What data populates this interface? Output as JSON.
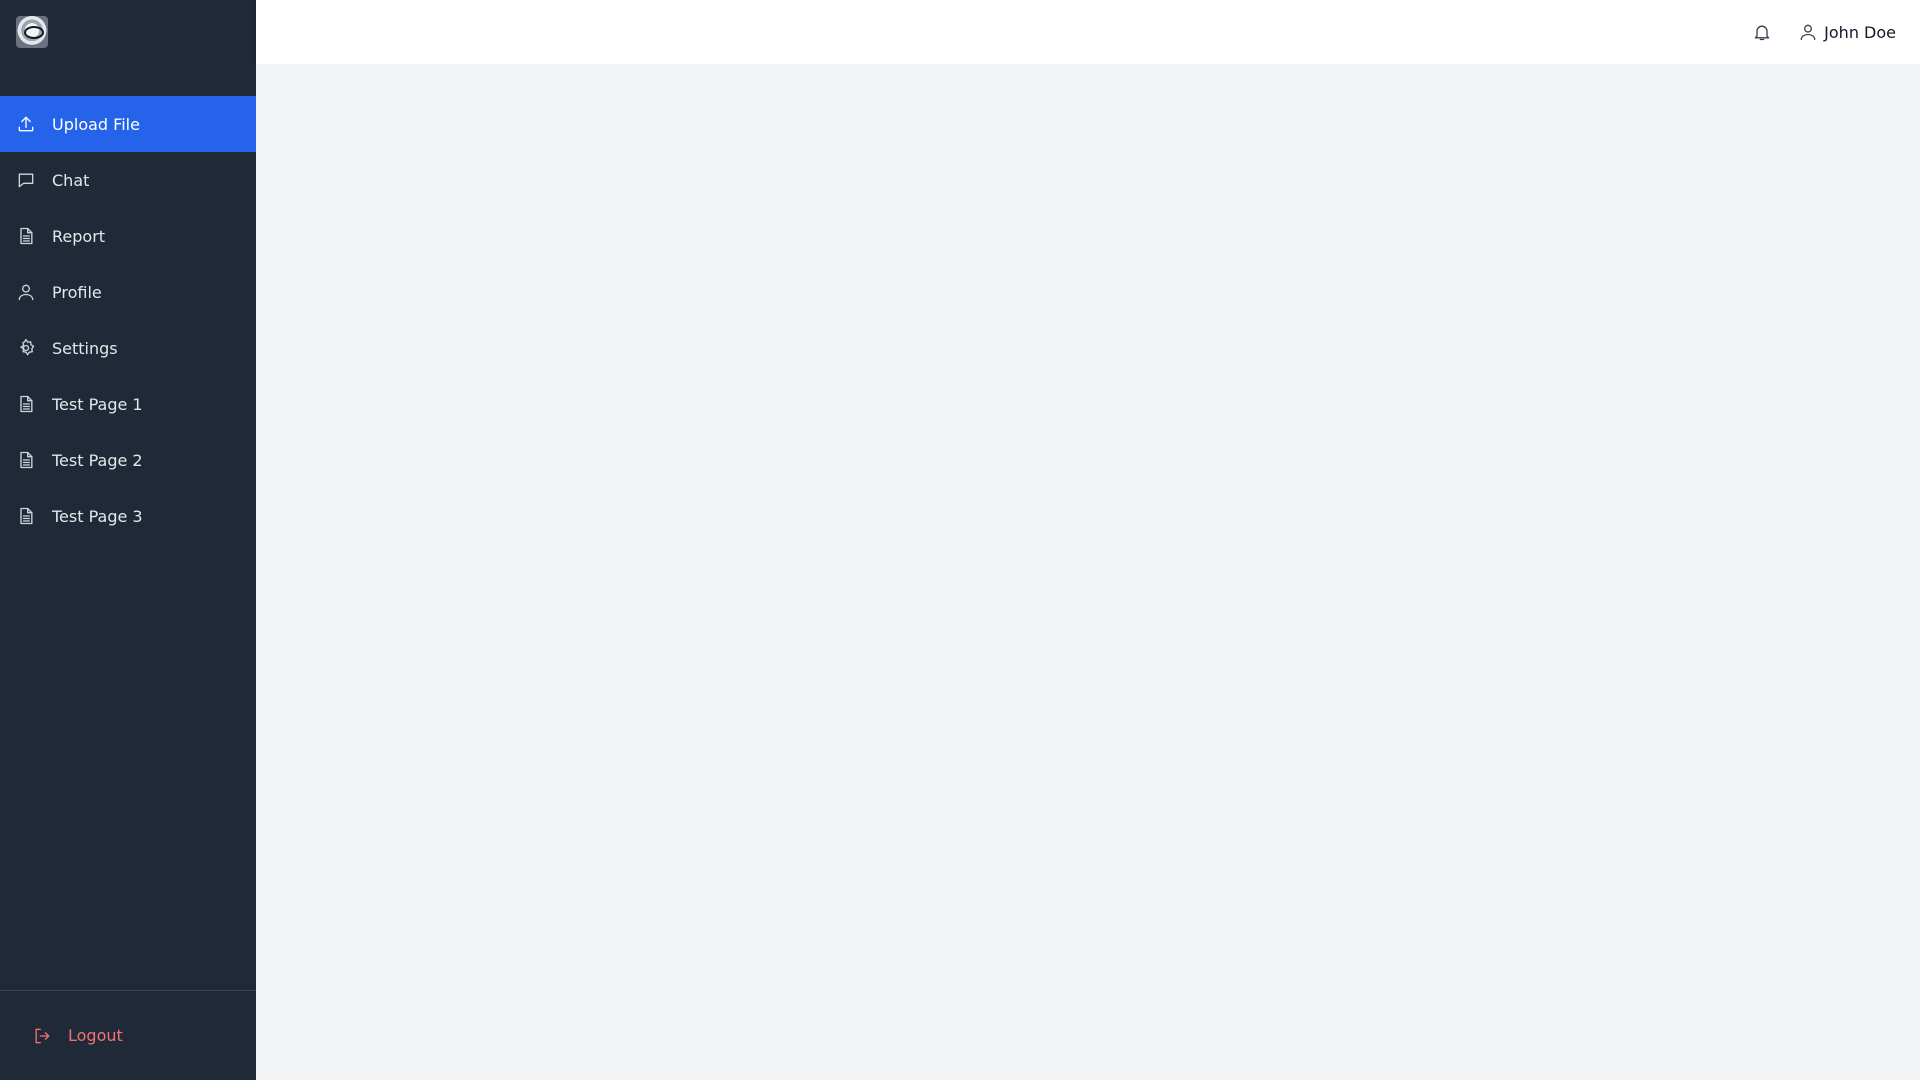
{
  "sidebar": {
    "logo_icon": "app-logo-icon",
    "items": [
      {
        "label": "Upload File",
        "icon": "upload-icon",
        "active": true
      },
      {
        "label": "Chat",
        "icon": "chat-icon",
        "active": false
      },
      {
        "label": "Report",
        "icon": "document-icon",
        "active": false
      },
      {
        "label": "Profile",
        "icon": "user-icon",
        "active": false
      },
      {
        "label": "Settings",
        "icon": "gear-icon",
        "active": false
      },
      {
        "label": "Test Page 1",
        "icon": "document-icon",
        "active": false
      },
      {
        "label": "Test Page 2",
        "icon": "document-icon",
        "active": false
      },
      {
        "label": "Test Page 3",
        "icon": "document-icon",
        "active": false
      }
    ],
    "logout_label": "Logout"
  },
  "header": {
    "user_name": "John Doe"
  },
  "colors": {
    "sidebar_bg": "#1f2937",
    "active_item": "#2563eb",
    "logout": "#f87171",
    "content_bg": "#f3f4f6"
  }
}
